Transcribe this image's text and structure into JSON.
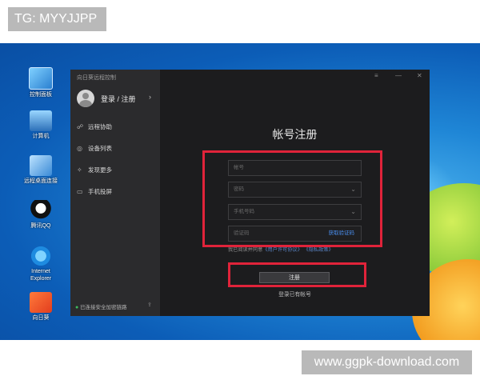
{
  "watermarks": {
    "top_left": "TG: MYYJJPP",
    "bottom_right": "www.ggpk-download.com"
  },
  "desktop": {
    "icons": [
      {
        "label": "控制面板",
        "icon": "control-panel-icon"
      },
      {
        "label": "计算机",
        "icon": "computer-icon"
      },
      {
        "label": "远程桌面连接",
        "icon": "remote-desktop-icon"
      },
      {
        "label": "腾讯QQ",
        "icon": "qq-icon"
      },
      {
        "label": "Internet Explorer",
        "icon": "ie-icon"
      },
      {
        "label": "向日葵",
        "icon": "sunlogin-icon"
      }
    ]
  },
  "app": {
    "title": "向日葵远程控制",
    "login_label": "登录 / 注册",
    "login_chevron": "›",
    "nav": [
      {
        "label": "远程协助",
        "icon": "☍"
      },
      {
        "label": "设备列表",
        "icon": "◎"
      },
      {
        "label": "发现更多",
        "icon": "✧"
      },
      {
        "label": "手机投屏",
        "icon": "▭"
      }
    ],
    "footer_status": "已连接安全加密链路",
    "window_controls": {
      "menu": "≡",
      "minimize": "—",
      "close": "✕"
    },
    "form": {
      "title": "帐号注册",
      "account_placeholder": "帐号",
      "password_placeholder": "密码",
      "phone_placeholder": "手机号码",
      "code_placeholder": "验证码",
      "get_code_label": "获取验证码",
      "agreement_prefix": "我已阅读并同意",
      "agreement_link1": "《用户许可协议》",
      "agreement_link2": "《隐私政策》",
      "register_label": "注册",
      "has_account_label": "登录已有帐号",
      "caret": "⌄"
    }
  },
  "colors": {
    "highlight_red": "#e0233a",
    "link_blue": "#4a8ff0",
    "status_green": "#3dbb5b"
  }
}
